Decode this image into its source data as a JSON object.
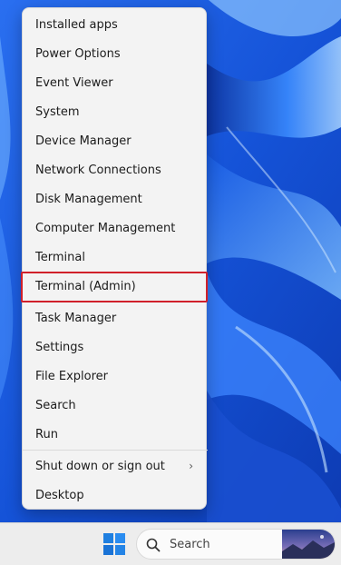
{
  "context_menu": {
    "items": [
      {
        "label": "Installed apps"
      },
      {
        "label": "Power Options"
      },
      {
        "label": "Event Viewer"
      },
      {
        "label": "System"
      },
      {
        "label": "Device Manager"
      },
      {
        "label": "Network Connections"
      },
      {
        "label": "Disk Management"
      },
      {
        "label": "Computer Management"
      },
      {
        "label": "Terminal"
      },
      {
        "label": "Terminal (Admin)",
        "highlighted": true
      },
      {
        "label": "Task Manager"
      },
      {
        "label": "Settings"
      },
      {
        "label": "File Explorer"
      },
      {
        "label": "Search"
      },
      {
        "label": "Run"
      },
      {
        "label": "Shut down or sign out",
        "submenu": true
      },
      {
        "label": "Desktop"
      }
    ],
    "submenu_indicator": "›",
    "highlight_color": "#d0202a"
  },
  "taskbar": {
    "start_icon": "windows-logo-icon",
    "search": {
      "icon": "search-icon",
      "placeholder": "Search"
    }
  },
  "colors": {
    "wallpaper_accent": "#1a63e8",
    "menu_background": "#f3f3f3",
    "start_icon": "#1f7fe0"
  }
}
